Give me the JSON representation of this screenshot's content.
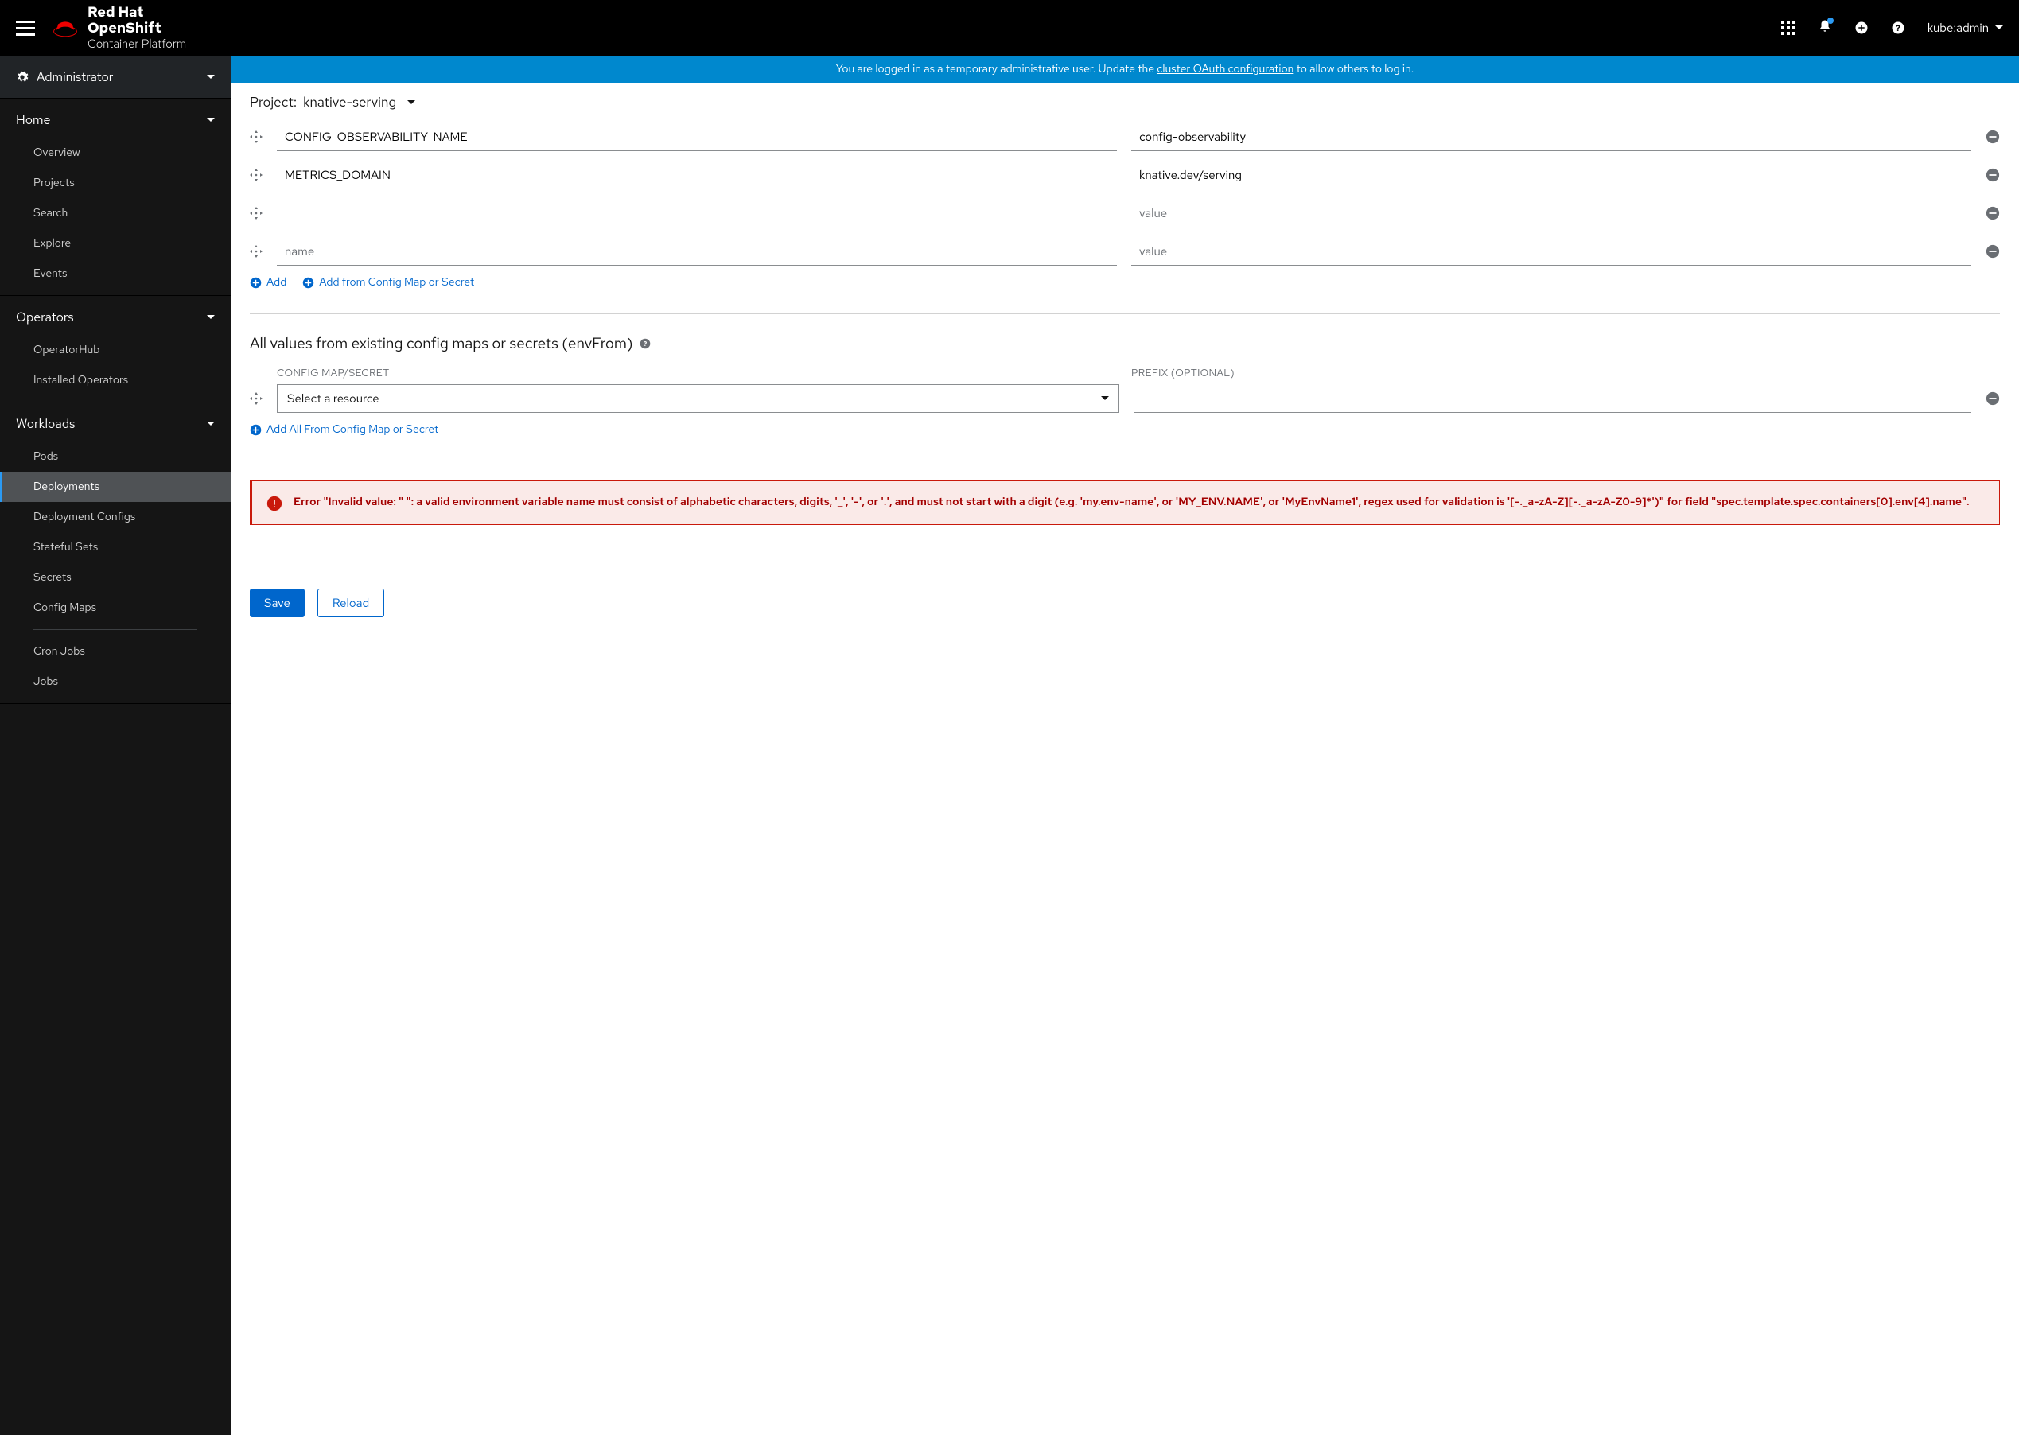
{
  "brand": {
    "l1": "Red Hat",
    "l2_a": "OpenShift",
    "l2_b": "Container Platform"
  },
  "user": "kube:admin",
  "perspective": "Administrator",
  "sidebar": {
    "sections": [
      {
        "title": "Home",
        "items": [
          "Overview",
          "Projects",
          "Search",
          "Explore",
          "Events"
        ]
      },
      {
        "title": "Operators",
        "items": [
          "OperatorHub",
          "Installed Operators"
        ]
      },
      {
        "title": "Workloads",
        "items": [
          "Pods",
          "Deployments",
          "Deployment Configs",
          "Stateful Sets",
          "Secrets",
          "Config Maps"
        ],
        "items2": [
          "Cron Jobs",
          "Jobs"
        ],
        "active": 1
      }
    ]
  },
  "banner": {
    "pre": "You are logged in as a temporary administrative user. Update the ",
    "link": "cluster OAuth configuration",
    "post": " to allow others to log in."
  },
  "project": {
    "label": "Project:",
    "value": "knative-serving"
  },
  "env_rows": [
    {
      "name": "CONFIG_OBSERVABILITY_NAME",
      "value": "config-observability",
      "nph": "",
      "vph": ""
    },
    {
      "name": "METRICS_DOMAIN",
      "value": "knative.dev/serving",
      "nph": "",
      "vph": ""
    },
    {
      "name": "",
      "value": "",
      "nph": "",
      "vph": "value"
    },
    {
      "name": "",
      "value": "",
      "nph": "name",
      "vph": "value"
    }
  ],
  "add_links": {
    "add": "Add",
    "add_from": "Add from Config Map or Secret"
  },
  "envfrom": {
    "title": "All values from existing config maps or secrets (envFrom)",
    "col1": "CONFIG MAP/SECRET",
    "col2": "PREFIX (OPTIONAL)",
    "select_ph": "Select a resource",
    "add_all": "Add All From Config Map or Secret"
  },
  "error": "Error \"Invalid value: \" \": a valid environment variable name must consist of alphabetic characters, digits, '_', '-', or '.', and must not start with a digit (e.g. 'my.env-name', or 'MY_ENV.NAME', or 'MyEnvName1', regex used for validation is '[-._a-zA-Z][-._a-zA-Z0-9]*')\" for field \"spec.template.spec.containers[0].env[4].name\".",
  "buttons": {
    "save": "Save",
    "reload": "Reload"
  }
}
